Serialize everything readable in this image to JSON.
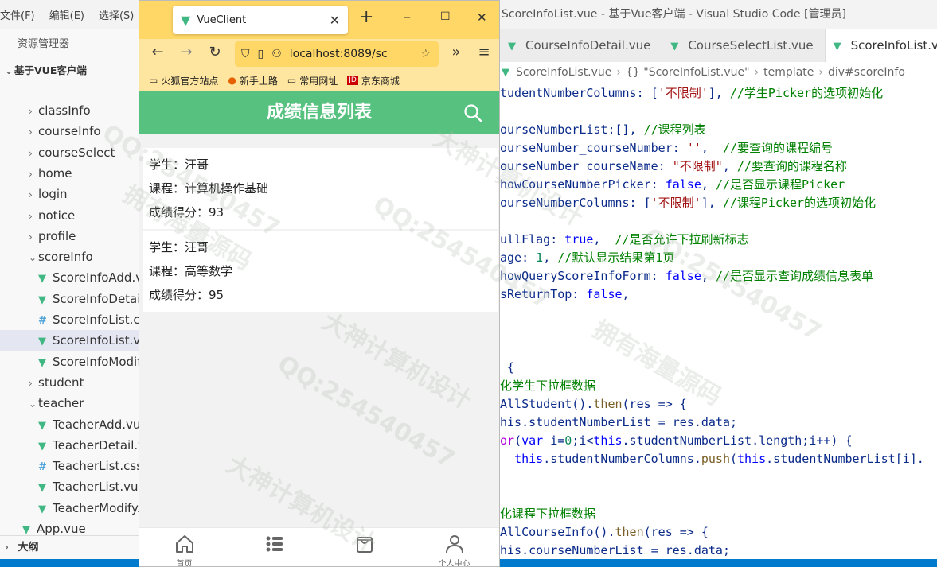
{
  "vscode": {
    "menu": [
      "文件(F)",
      "编辑(E)",
      "选择(S)"
    ],
    "explorer_title": "资源管理器",
    "project_name": "基于VUE客户端",
    "tree": [
      {
        "label": "classInfo",
        "type": "folder",
        "state": "collapsed"
      },
      {
        "label": "courseInfo",
        "type": "folder",
        "state": "collapsed"
      },
      {
        "label": "courseSelect",
        "type": "folder",
        "state": "collapsed"
      },
      {
        "label": "home",
        "type": "folder",
        "state": "collapsed"
      },
      {
        "label": "login",
        "type": "folder",
        "state": "collapsed"
      },
      {
        "label": "notice",
        "type": "folder",
        "state": "collapsed"
      },
      {
        "label": "profile",
        "type": "folder",
        "state": "collapsed"
      },
      {
        "label": "scoreInfo",
        "type": "folder",
        "state": "expanded"
      },
      {
        "label": "ScoreInfoAdd.vue",
        "type": "vue"
      },
      {
        "label": "ScoreInfoDetail.vue",
        "type": "vue"
      },
      {
        "label": "ScoreInfoList.css",
        "type": "css"
      },
      {
        "label": "ScoreInfoList.vue",
        "type": "vue",
        "selected": true
      },
      {
        "label": "ScoreInfoModify.vue",
        "type": "vue"
      },
      {
        "label": "student",
        "type": "folder",
        "state": "collapsed"
      },
      {
        "label": "teacher",
        "type": "folder",
        "state": "expanded"
      },
      {
        "label": "TeacherAdd.vue",
        "type": "vue"
      },
      {
        "label": "TeacherDetail.vue",
        "type": "vue"
      },
      {
        "label": "TeacherList.css",
        "type": "css"
      },
      {
        "label": "TeacherList.vue",
        "type": "vue"
      },
      {
        "label": "TeacherModify.vue",
        "type": "vue"
      },
      {
        "label": "App.vue",
        "type": "vue"
      }
    ],
    "outline_label": "大纲",
    "window_title": "ScoreInfoList.vue - 基于Vue客户端 - Visual Studio Code [管理员]",
    "tabs": [
      "CourseInfoDetail.vue",
      "CourseSelectList.vue",
      "ScoreInfoList.vue"
    ],
    "breadcrumb": [
      "ScoreInfoList.vue",
      "{} \"ScoreInfoList.vue\"",
      "template",
      "div#scoreInfo"
    ],
    "code_lines": [
      "tudentNumberColumns: ['不限制'], //学生Picker的选项初始化",
      "",
      "ourseNumberList:[], //课程列表",
      "ourseNumber_courseNumber: '',  //要查询的课程编号",
      "ourseNumber_courseName: \"不限制\", //要查询的课程名称",
      "howCourseNumberPicker: false, //是否显示课程Picker",
      "ourseNumberColumns: ['不限制'], //课程Picker的选项初始化",
      "",
      "ullFlag: true,  //是否允许下拉刷新标志",
      "age: 1, //默认显示结果第1页",
      "howQueryScoreInfoForm: false, //是否显示查询成绩信息表单",
      "sReturnTop: false,",
      "",
      "",
      "",
      " {",
      "化学生下拉框数据",
      "AllStudent().then(res => {",
      "his.studentNumberList = res.data;",
      "or(var i=0;i<this.studentNumberList.length;i++) {",
      "  this.studentNumberColumns.push(this.studentNumberList[i].",
      "",
      "",
      "化课程下拉框数据",
      "AllCourseInfo().then(res => {",
      "his.courseNumberList = res.data;"
    ]
  },
  "browser": {
    "tab_title": "VueClient",
    "url": "localhost:8089/sc",
    "bookmarks": [
      "火狐官方站点",
      "新手上路",
      "常用网址",
      "京东商城"
    ]
  },
  "app": {
    "title": "成绩信息列表",
    "records": [
      {
        "student_label": "学生：",
        "student": "汪哥",
        "course_label": "课程：",
        "course": "计算机操作基础",
        "score_label": "成绩得分：",
        "score": "93"
      },
      {
        "student_label": "学生：",
        "student": "汪哥",
        "course_label": "课程：",
        "course": "高等数学",
        "score_label": "成绩得分：",
        "score": "95"
      }
    ],
    "tabbar": [
      "首页",
      "个人中心"
    ],
    "tabbar_icons": [
      "home-icon",
      "list-icon",
      "bag-icon",
      "user-icon"
    ]
  },
  "watermarks": [
    "QQ:254540457",
    "大神计算机设计",
    "拥有海量源码"
  ]
}
